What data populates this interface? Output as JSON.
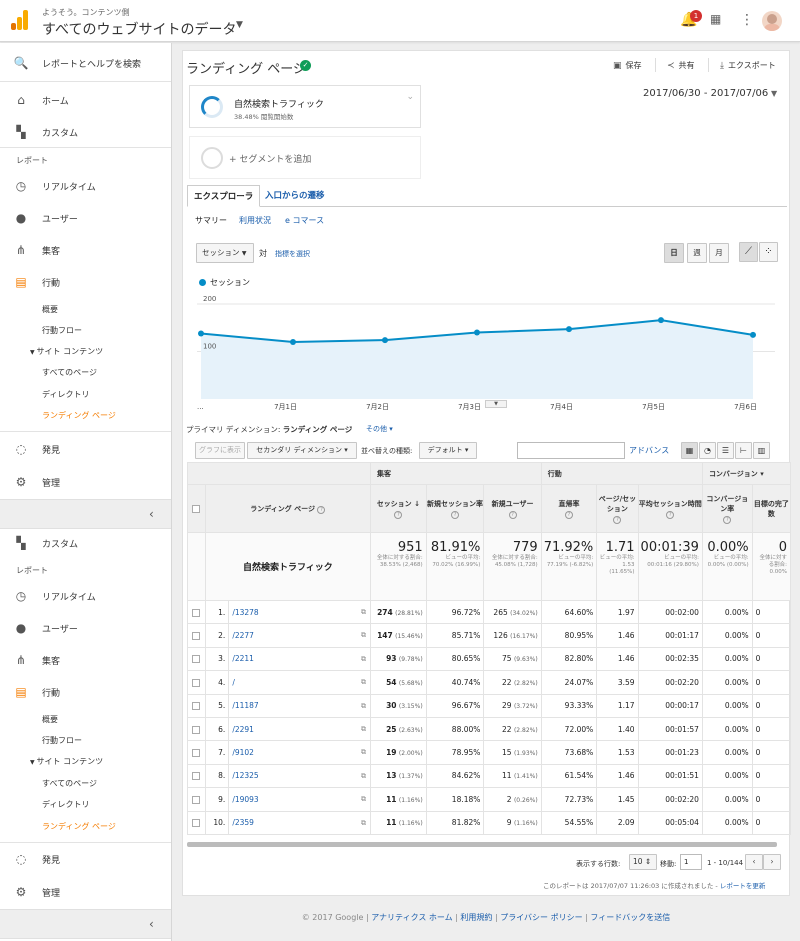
{
  "topbar": {
    "account": "ようそう。コンテンツ側",
    "property": "すべてのウェブサイトのデータ",
    "notification_count": "1"
  },
  "sidebar": {
    "search": "レポートとヘルプを検索",
    "home": "ホーム",
    "custom": "カスタム",
    "reports_section": "レポート",
    "realtime": "リアルタイム",
    "audience": "ユーザー",
    "acquisition": "集客",
    "behavior": "行動",
    "behavior_items": [
      "概要",
      "行動フロー",
      "サイト コンテンツ",
      "すべてのページ",
      "ディレクトリ",
      "ランディング ページ"
    ],
    "discover": "発見",
    "admin": "管理"
  },
  "header": {
    "title": "ランディング ページ",
    "save": "保存",
    "share": "共有",
    "export": "エクスポート"
  },
  "segments": {
    "active_name": "自然検索トラフィック",
    "active_sub": "38.48% 閲覧開始数",
    "add": "+ セグメントを追加"
  },
  "date_range": "2017/06/30 - 2017/07/06",
  "tabs": [
    "エクスプローラ",
    "入口からの遷移"
  ],
  "subtabs": [
    "サマリー",
    "利用状況",
    "e コマース"
  ],
  "chart_controls": {
    "metric": "セッション",
    "vs": "対",
    "pick": "指標を選択",
    "day": "日",
    "week": "週",
    "month": "月"
  },
  "chart_data": {
    "type": "area",
    "series": [
      {
        "name": "セッション",
        "values": [
          138,
          120,
          124,
          140,
          147,
          166,
          135
        ]
      }
    ],
    "x_ticks": [
      "...",
      "7月1日",
      "7月2日",
      "7月3日",
      "7月4日",
      "7月5日",
      "7月6日"
    ],
    "y_ticks": [
      100,
      200
    ],
    "ylim": [
      0,
      200
    ],
    "color": "#058dc7"
  },
  "dimension": {
    "label": "プライマリ ディメンション:",
    "value": "ランディング ページ",
    "other": "その他"
  },
  "table_toolbar": {
    "graph": "グラフに表示",
    "secondary": "セカンダリ ディメンション",
    "sort_label": "並べ替えの種類:",
    "sort": "デフォルト",
    "advanced": "アドバンス"
  },
  "table": {
    "col_page": "ランディング ページ",
    "group_acq": "集客",
    "group_beh": "行動",
    "group_conv": "コンバージョン",
    "headers": [
      "セッション",
      "新規セッション率",
      "新規ユーザー",
      "直帰率",
      "ページ/セッション",
      "平均セッション時間",
      "コンバージョン率",
      "目標の完了数"
    ],
    "totals": {
      "segment": "自然検索トラフィック",
      "values": [
        "951",
        "81.91%",
        "779",
        "71.92%",
        "1.71",
        "00:01:39",
        "0.00%",
        "0"
      ],
      "subs": [
        "全体に対する割合: 38.53% (2,468)",
        "ビューの平均: 70.02% (16.99%)",
        "全体に対する割合: 45.08% (1,728)",
        "ビューの平均: 77.19% (-6.82%)",
        "ビューの平均: 1.53 (11.65%)",
        "ビューの平均: 00:01:16 (29.80%)",
        "ビューの平均: 0.00% (0.00%)",
        "全体に対する割合: 0.00%"
      ]
    },
    "rows": [
      {
        "i": "1.",
        "page": "/13278",
        "s": "274",
        "sp": "(28.81%)",
        "n": "96.72%",
        "u": "265",
        "up": "(34.02%)",
        "b": "64.60%",
        "p": "1.97",
        "t": "00:02:00",
        "c": "0.00%",
        "g": "0"
      },
      {
        "i": "2.",
        "page": "/2277",
        "s": "147",
        "sp": "(15.46%)",
        "n": "85.71%",
        "u": "126",
        "up": "(16.17%)",
        "b": "80.95%",
        "p": "1.46",
        "t": "00:01:17",
        "c": "0.00%",
        "g": "0"
      },
      {
        "i": "3.",
        "page": "/2211",
        "s": "93",
        "sp": "(9.78%)",
        "n": "80.65%",
        "u": "75",
        "up": "(9.63%)",
        "b": "82.80%",
        "p": "1.46",
        "t": "00:02:35",
        "c": "0.00%",
        "g": "0"
      },
      {
        "i": "4.",
        "page": "/",
        "s": "54",
        "sp": "(5.68%)",
        "n": "40.74%",
        "u": "22",
        "up": "(2.82%)",
        "b": "24.07%",
        "p": "3.59",
        "t": "00:02:20",
        "c": "0.00%",
        "g": "0"
      },
      {
        "i": "5.",
        "page": "/11187",
        "s": "30",
        "sp": "(3.15%)",
        "n": "96.67%",
        "u": "29",
        "up": "(3.72%)",
        "b": "93.33%",
        "p": "1.17",
        "t": "00:00:17",
        "c": "0.00%",
        "g": "0"
      },
      {
        "i": "6.",
        "page": "/2291",
        "s": "25",
        "sp": "(2.63%)",
        "n": "88.00%",
        "u": "22",
        "up": "(2.82%)",
        "b": "72.00%",
        "p": "1.40",
        "t": "00:01:57",
        "c": "0.00%",
        "g": "0"
      },
      {
        "i": "7.",
        "page": "/9102",
        "s": "19",
        "sp": "(2.00%)",
        "n": "78.95%",
        "u": "15",
        "up": "(1.93%)",
        "b": "73.68%",
        "p": "1.53",
        "t": "00:01:23",
        "c": "0.00%",
        "g": "0"
      },
      {
        "i": "8.",
        "page": "/12325",
        "s": "13",
        "sp": "(1.37%)",
        "n": "84.62%",
        "u": "11",
        "up": "(1.41%)",
        "b": "61.54%",
        "p": "1.46",
        "t": "00:01:51",
        "c": "0.00%",
        "g": "0"
      },
      {
        "i": "9.",
        "page": "/19093",
        "s": "11",
        "sp": "(1.16%)",
        "n": "18.18%",
        "u": "2",
        "up": "(0.26%)",
        "b": "72.73%",
        "p": "1.45",
        "t": "00:02:20",
        "c": "0.00%",
        "g": "0"
      },
      {
        "i": "10.",
        "page": "/2359",
        "s": "11",
        "sp": "(1.16%)",
        "n": "81.82%",
        "u": "9",
        "up": "(1.16%)",
        "b": "54.55%",
        "p": "2.09",
        "t": "00:05:04",
        "c": "0.00%",
        "g": "0"
      }
    ]
  },
  "pager": {
    "rows_label": "表示する行数:",
    "rows": "10",
    "goto_label": "移動:",
    "goto": "1",
    "range": "1 - 10/144"
  },
  "created": {
    "text": "このレポートは 2017/07/07 11:26:03 に作成されました - ",
    "link": "レポートを更新"
  },
  "footer": {
    "copy": "© 2017 Google | ",
    "l1": "アナリティクス ホーム",
    "l2": "利用規約",
    "l3": "プライバシー ポリシー",
    "l4": "フィードバックを送信",
    "sep": " | "
  }
}
